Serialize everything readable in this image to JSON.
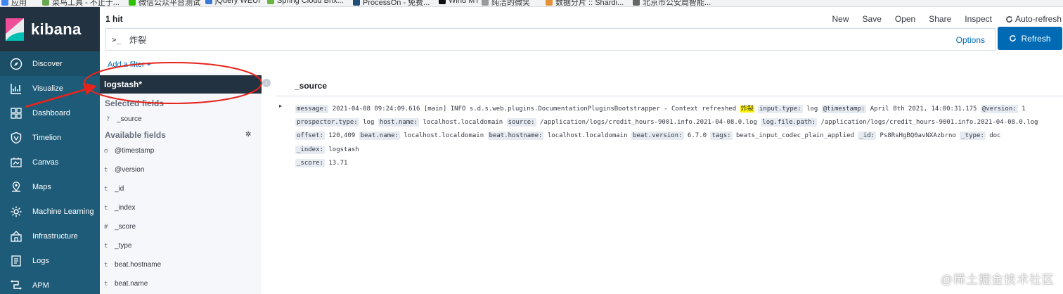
{
  "bookmarks": [
    {
      "label": "应用",
      "color": "#4285f4"
    },
    {
      "label": "菜鸟工具 - 不止于...",
      "color": "#6aa84f"
    },
    {
      "label": "微信公众平台测试",
      "color": "#2dc100"
    },
    {
      "label": "jQuery WEUI",
      "color": "#3c78d8"
    },
    {
      "label": "Spring Cloud Brix...",
      "color": "#6db33f"
    },
    {
      "label": "ProcessOn - 免费...",
      "color": "#1f4e79"
    },
    {
      "label": "Wind MT",
      "color": "#111111"
    },
    {
      "label": "纯洁的微笑",
      "color": "#999999"
    },
    {
      "label": "数据分片 :: Shardi...",
      "color": "#e69138"
    },
    {
      "label": "北京市公安局智能...",
      "color": "#666666"
    }
  ],
  "brand": {
    "name": "kibana"
  },
  "sidenav": [
    {
      "label": "Discover",
      "icon": "compass-icon"
    },
    {
      "label": "Visualize",
      "icon": "chart-icon"
    },
    {
      "label": "Dashboard",
      "icon": "dashboard-icon"
    },
    {
      "label": "Timelion",
      "icon": "shield-icon"
    },
    {
      "label": "Canvas",
      "icon": "canvas-icon"
    },
    {
      "label": "Maps",
      "icon": "map-icon"
    },
    {
      "label": "Machine Learning",
      "icon": "ml-icon"
    },
    {
      "label": "Infrastructure",
      "icon": "infra-icon"
    },
    {
      "label": "Logs",
      "icon": "logs-icon"
    },
    {
      "label": "APM",
      "icon": "apm-icon"
    }
  ],
  "topbar": {
    "hits": "1 hit",
    "menu": [
      "New",
      "Save",
      "Open",
      "Share",
      "Inspect"
    ],
    "auto_refresh": "Auto-refresh"
  },
  "query": {
    "prompt": ">_",
    "text": "炸裂",
    "options": "Options",
    "refresh": "Refresh"
  },
  "filter": {
    "add_label": "Add a filter +"
  },
  "fields": {
    "index_pattern": "logstash*",
    "selected_heading": "Selected fields",
    "selected": [
      {
        "type": "?",
        "name": "_source"
      }
    ],
    "available_heading": "Available fields",
    "available": [
      {
        "type": "clock",
        "name": "@timestamp"
      },
      {
        "type": "t",
        "name": "@version"
      },
      {
        "type": "t",
        "name": "_id"
      },
      {
        "type": "t",
        "name": "_index"
      },
      {
        "type": "#",
        "name": "_score"
      },
      {
        "type": "t",
        "name": "_type"
      },
      {
        "type": "t",
        "name": "beat.hostname"
      },
      {
        "type": "t",
        "name": "beat.name"
      }
    ]
  },
  "doc_table": {
    "column": "_source",
    "rows": [
      [
        {
          "key": "message:",
          "value": "2021-04-08 09:24:09.616 [main] INFO s.d.s.web.plugins.DocumentationPluginsBootstrapper - Context refreshed",
          "highlight": "炸裂"
        },
        {
          "key": "input.type:",
          "value": "log"
        },
        {
          "key": "@timestamp:",
          "value": "April 8th 2021, 14:00:31.175"
        },
        {
          "key": "@version:",
          "value": "1"
        },
        {
          "key": "prospector.type:",
          "value": "log"
        },
        {
          "key": "host.name:",
          "value": "localhost.localdomain"
        },
        {
          "key": "source:",
          "value": "/application/logs/credit_hours-9001.info.2021-04-08.0.log"
        },
        {
          "key": "log.file.path:",
          "value": "/application/logs/credit_hours-9001.info.2021-04-08.0.log"
        },
        {
          "key": "offset:",
          "value": "120,409"
        },
        {
          "key": "beat.name:",
          "value": "localhost.localdomain"
        },
        {
          "key": "beat.hostname:",
          "value": "localhost.localdomain"
        },
        {
          "key": "beat.version:",
          "value": "6.7.0"
        },
        {
          "key": "tags:",
          "value": "beats_input_codec_plain_applied"
        },
        {
          "key": "_id:",
          "value": "Ps8RsHgBQ0avNXAzbrno"
        },
        {
          "key": "_type:",
          "value": "doc"
        },
        {
          "key": "_index:",
          "value": "logstash"
        },
        {
          "key": "_score:",
          "value": "13.71"
        }
      ]
    ]
  },
  "colors": {
    "accent": "#006bb4",
    "nav_bg": "#1e5b78",
    "brand_bg": "#233240",
    "annotation": "#e8231b",
    "highlight": "#fff200"
  },
  "watermark": "@稀土掘金技术社区"
}
